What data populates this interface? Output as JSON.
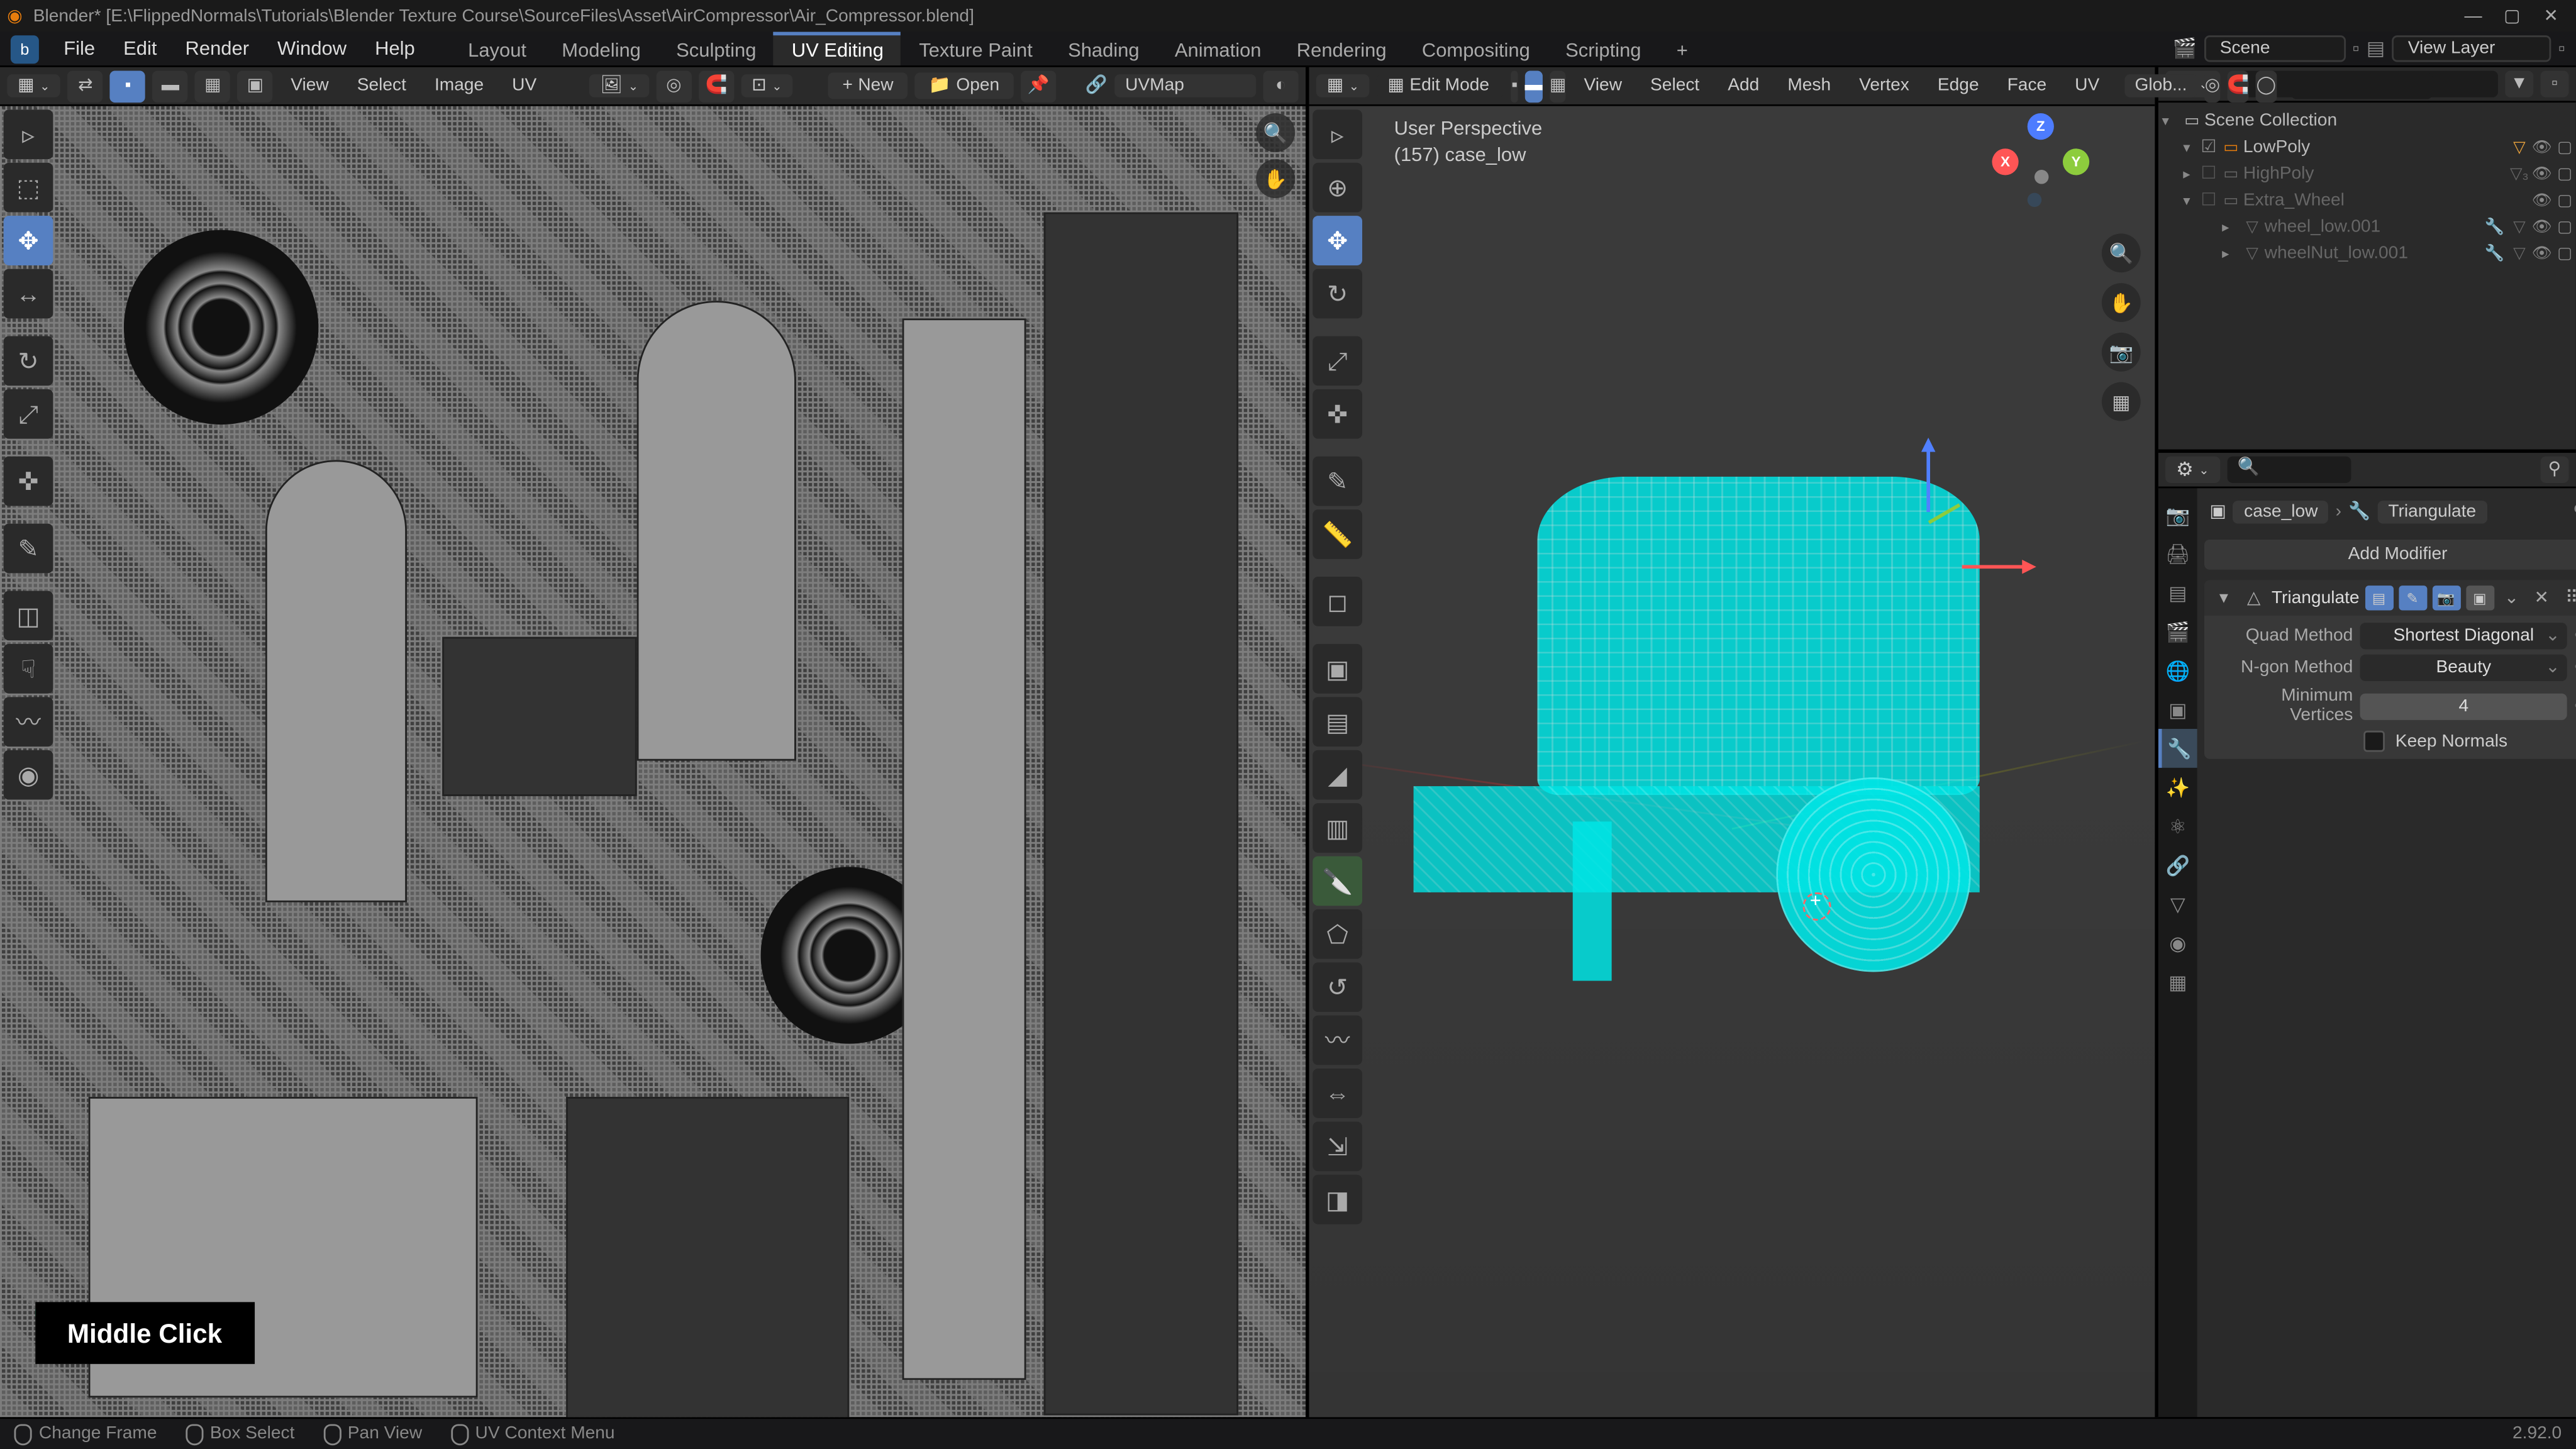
{
  "app": {
    "title": "Blender* [E:\\FlippedNormals\\Tutorials\\Blender Texture Course\\SourceFiles\\Asset\\AirCompressor\\Air_Compressor.blend]"
  },
  "menu": {
    "file": "File",
    "edit": "Edit",
    "render": "Render",
    "window": "Window",
    "help": "Help"
  },
  "workspaces": {
    "layout": "Layout",
    "modeling": "Modeling",
    "sculpting": "Sculpting",
    "uv_editing": "UV Editing",
    "texture_paint": "Texture Paint",
    "shading": "Shading",
    "animation": "Animation",
    "rendering": "Rendering",
    "compositing": "Compositing",
    "scripting": "Scripting",
    "add": "+"
  },
  "topbar_right": {
    "scene": "Scene",
    "view_layer": "View Layer"
  },
  "uv_editor": {
    "view": "View",
    "select": "Select",
    "image": "Image",
    "uv": "UV",
    "new": "New",
    "open": "Open",
    "uvmap": "UVMap"
  },
  "view3d": {
    "mode": "Edit Mode",
    "view": "View",
    "select": "Select",
    "add": "Add",
    "mesh": "Mesh",
    "vertex": "Vertex",
    "edge": "Edge",
    "face": "Face",
    "uv": "UV",
    "global": "Glob...",
    "perspective_label": "User Perspective",
    "object_label": "(157) case_low"
  },
  "outliner": {
    "scene_collection": "Scene Collection",
    "items": [
      {
        "label": "LowPoly",
        "depth": 1,
        "type": "collection",
        "enabled": true,
        "expanded": true
      },
      {
        "label": "HighPoly",
        "depth": 1,
        "type": "collection",
        "enabled": false,
        "expanded": false
      },
      {
        "label": "Extra_Wheel",
        "depth": 1,
        "type": "collection",
        "enabled": false,
        "expanded": true
      },
      {
        "label": "wheel_low.001",
        "depth": 2,
        "type": "mesh",
        "enabled": false
      },
      {
        "label": "wheelNut_low.001",
        "depth": 2,
        "type": "mesh",
        "enabled": false
      }
    ]
  },
  "properties": {
    "breadcrumb_object": "case_low",
    "breadcrumb_modifier": "Triangulate",
    "add_modifier": "Add Modifier",
    "modifier": {
      "name": "Triangulate",
      "quad_method_label": "Quad Method",
      "quad_method_value": "Shortest Diagonal",
      "ngon_method_label": "N-gon Method",
      "ngon_method_value": "Beauty",
      "min_verts_label": "Minimum Vertices",
      "min_verts_value": "4",
      "keep_normals": "Keep Normals"
    }
  },
  "statusbar": {
    "change_frame": "Change Frame",
    "box_select": "Box Select",
    "pan_view": "Pan View",
    "context_menu": "UV Context Menu",
    "version": "2.92.0"
  },
  "hint": "Middle Click"
}
